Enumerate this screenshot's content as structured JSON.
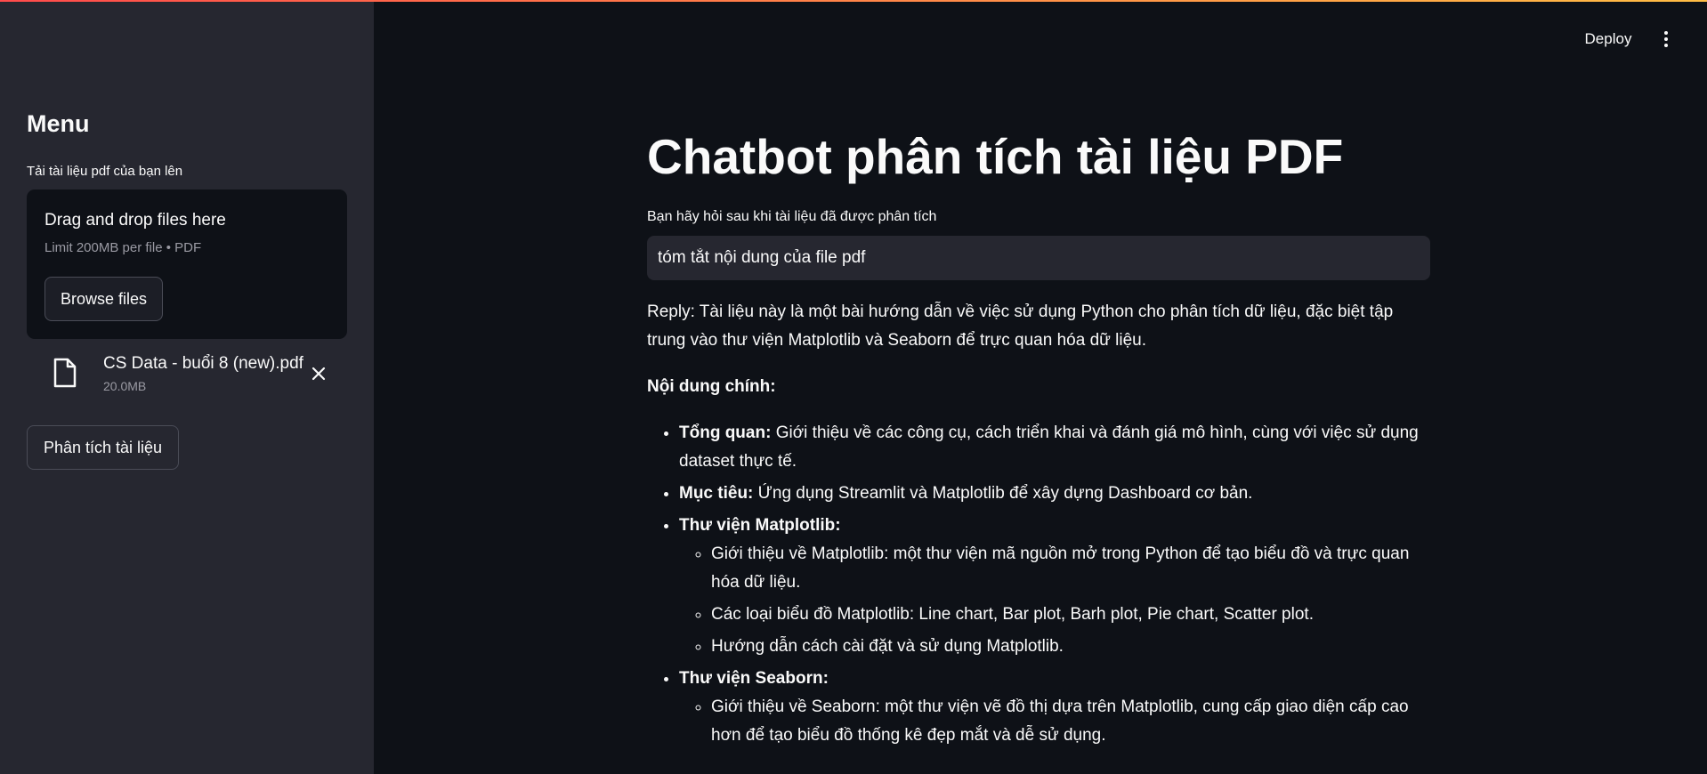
{
  "sidebar": {
    "title": "Menu",
    "uploader": {
      "label": "Tải tài liệu pdf của bạn lên",
      "drop_title": "Drag and drop files here",
      "limit": "Limit 200MB per file • PDF",
      "browse_label": "Browse files"
    },
    "file": {
      "name": "CS Data - buổi 8 (new).pdf",
      "size": "20.0MB"
    },
    "analyze_label": "Phân tích tài liệu"
  },
  "header": {
    "deploy_label": "Deploy"
  },
  "main": {
    "title": "Chatbot phân tích tài liệu PDF",
    "question_label": "Bạn hãy hỏi sau khi tài liệu đã được phân tích",
    "question_value": "tóm tắt nội dung của file pdf",
    "reply": {
      "intro": "Reply: Tài liệu này là một bài hướng dẫn về việc sử dụng Python cho phân tích dữ liệu, đặc biệt tập trung vào thư viện Matplotlib và Seaborn để trực quan hóa dữ liệu.",
      "heading": "Nội dung chính:",
      "items": [
        {
          "bold": "Tổng quan:",
          "text": " Giới thiệu về các công cụ, cách triển khai và đánh giá mô hình, cùng với việc sử dụng dataset thực tế."
        },
        {
          "bold": "Mục tiêu:",
          "text": " Ứng dụng Streamlit và Matplotlib để xây dựng Dashboard cơ bản."
        },
        {
          "bold": "Thư viện Matplotlib:",
          "subitems": [
            "Giới thiệu về Matplotlib: một thư viện mã nguồn mở trong Python để tạo biểu đồ và trực quan hóa dữ liệu.",
            "Các loại biểu đồ Matplotlib: Line chart, Bar plot, Barh plot, Pie chart, Scatter plot.",
            "Hướng dẫn cách cài đặt và sử dụng Matplotlib."
          ]
        },
        {
          "bold": "Thư viện Seaborn:",
          "subitems": [
            "Giới thiệu về Seaborn: một thư viện vẽ đồ thị dựa trên Matplotlib, cung cấp giao diện cấp cao hơn để tạo biểu đồ thống kê đẹp mắt và dễ sử dụng."
          ]
        }
      ]
    }
  }
}
